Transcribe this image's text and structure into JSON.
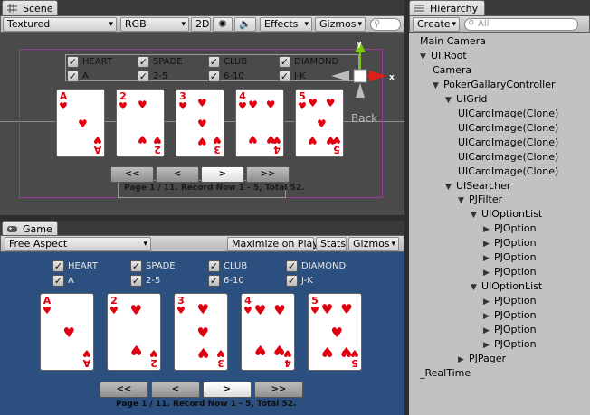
{
  "scene": {
    "tab_label": "Scene",
    "toolbar": {
      "render_mode": "Textured",
      "color_mode": "RGB",
      "mode_2d": "2D",
      "effects": "Effects",
      "gizmos": "Gizmos",
      "search_placeholder": ""
    },
    "back_label": "Back",
    "gizmo_axes": {
      "y": "y",
      "x": "x"
    }
  },
  "game": {
    "tab_label": "Game",
    "toolbar": {
      "aspect": "Free Aspect",
      "maximize": "Maximize on Play",
      "stats": "Stats",
      "gizmos": "Gizmos"
    }
  },
  "options": {
    "row1": [
      "HEART",
      "SPADE",
      "CLUB",
      "DIAMOND"
    ],
    "row2": [
      "A",
      "2-5",
      "6-10",
      "J-K"
    ],
    "checked": true
  },
  "cards": [
    {
      "rank": "A",
      "suit": "♥"
    },
    {
      "rank": "2",
      "suit": "♥"
    },
    {
      "rank": "3",
      "suit": "♥"
    },
    {
      "rank": "4",
      "suit": "♥"
    },
    {
      "rank": "5",
      "suit": "♥"
    }
  ],
  "pager": {
    "buttons": [
      "<<",
      "<",
      ">",
      ">>"
    ],
    "status": "Page 1 / 11. Record Now 1 - 5, Total 52."
  },
  "hierarchy": {
    "tab_label": "Hierarchy",
    "create_label": "Create",
    "search_placeholder": "All",
    "items": [
      {
        "label": "Main Camera",
        "indent": 0,
        "arrow": ""
      },
      {
        "label": "UI Root",
        "indent": 0,
        "arrow": "down"
      },
      {
        "label": "Camera",
        "indent": 1,
        "arrow": ""
      },
      {
        "label": "PokerGallaryController",
        "indent": 1,
        "arrow": "down"
      },
      {
        "label": "UIGrid",
        "indent": 2,
        "arrow": "down"
      },
      {
        "label": "UICardImage(Clone)",
        "indent": 3,
        "arrow": ""
      },
      {
        "label": "UICardImage(Clone)",
        "indent": 3,
        "arrow": ""
      },
      {
        "label": "UICardImage(Clone)",
        "indent": 3,
        "arrow": ""
      },
      {
        "label": "UICardImage(Clone)",
        "indent": 3,
        "arrow": ""
      },
      {
        "label": "UICardImage(Clone)",
        "indent": 3,
        "arrow": ""
      },
      {
        "label": "UISearcher",
        "indent": 2,
        "arrow": "down"
      },
      {
        "label": "PJFilter",
        "indent": 3,
        "arrow": "down"
      },
      {
        "label": "UIOptionList",
        "indent": 4,
        "arrow": "down"
      },
      {
        "label": "PJOption",
        "indent": 5,
        "arrow": "right"
      },
      {
        "label": "PJOption",
        "indent": 5,
        "arrow": "right"
      },
      {
        "label": "PJOption",
        "indent": 5,
        "arrow": "right"
      },
      {
        "label": "PJOption",
        "indent": 5,
        "arrow": "right"
      },
      {
        "label": "UIOptionList",
        "indent": 4,
        "arrow": "down"
      },
      {
        "label": "PJOption",
        "indent": 5,
        "arrow": "right"
      },
      {
        "label": "PJOption",
        "indent": 5,
        "arrow": "right"
      },
      {
        "label": "PJOption",
        "indent": 5,
        "arrow": "right"
      },
      {
        "label": "PJOption",
        "indent": 5,
        "arrow": "right"
      },
      {
        "label": "PJPager",
        "indent": 3,
        "arrow": "right"
      },
      {
        "label": "_RealTime",
        "indent": 0,
        "arrow": ""
      }
    ]
  },
  "colors": {
    "game_bg": "#2b4f7e",
    "scene_bg": "#4a4a4a",
    "hierarchy_bg": "#c2c2c2",
    "heart_red": "#e00010",
    "frame_purple": "#9b3c9b",
    "gizmo_green": "#7ac70c",
    "gizmo_red": "#d8221a"
  }
}
